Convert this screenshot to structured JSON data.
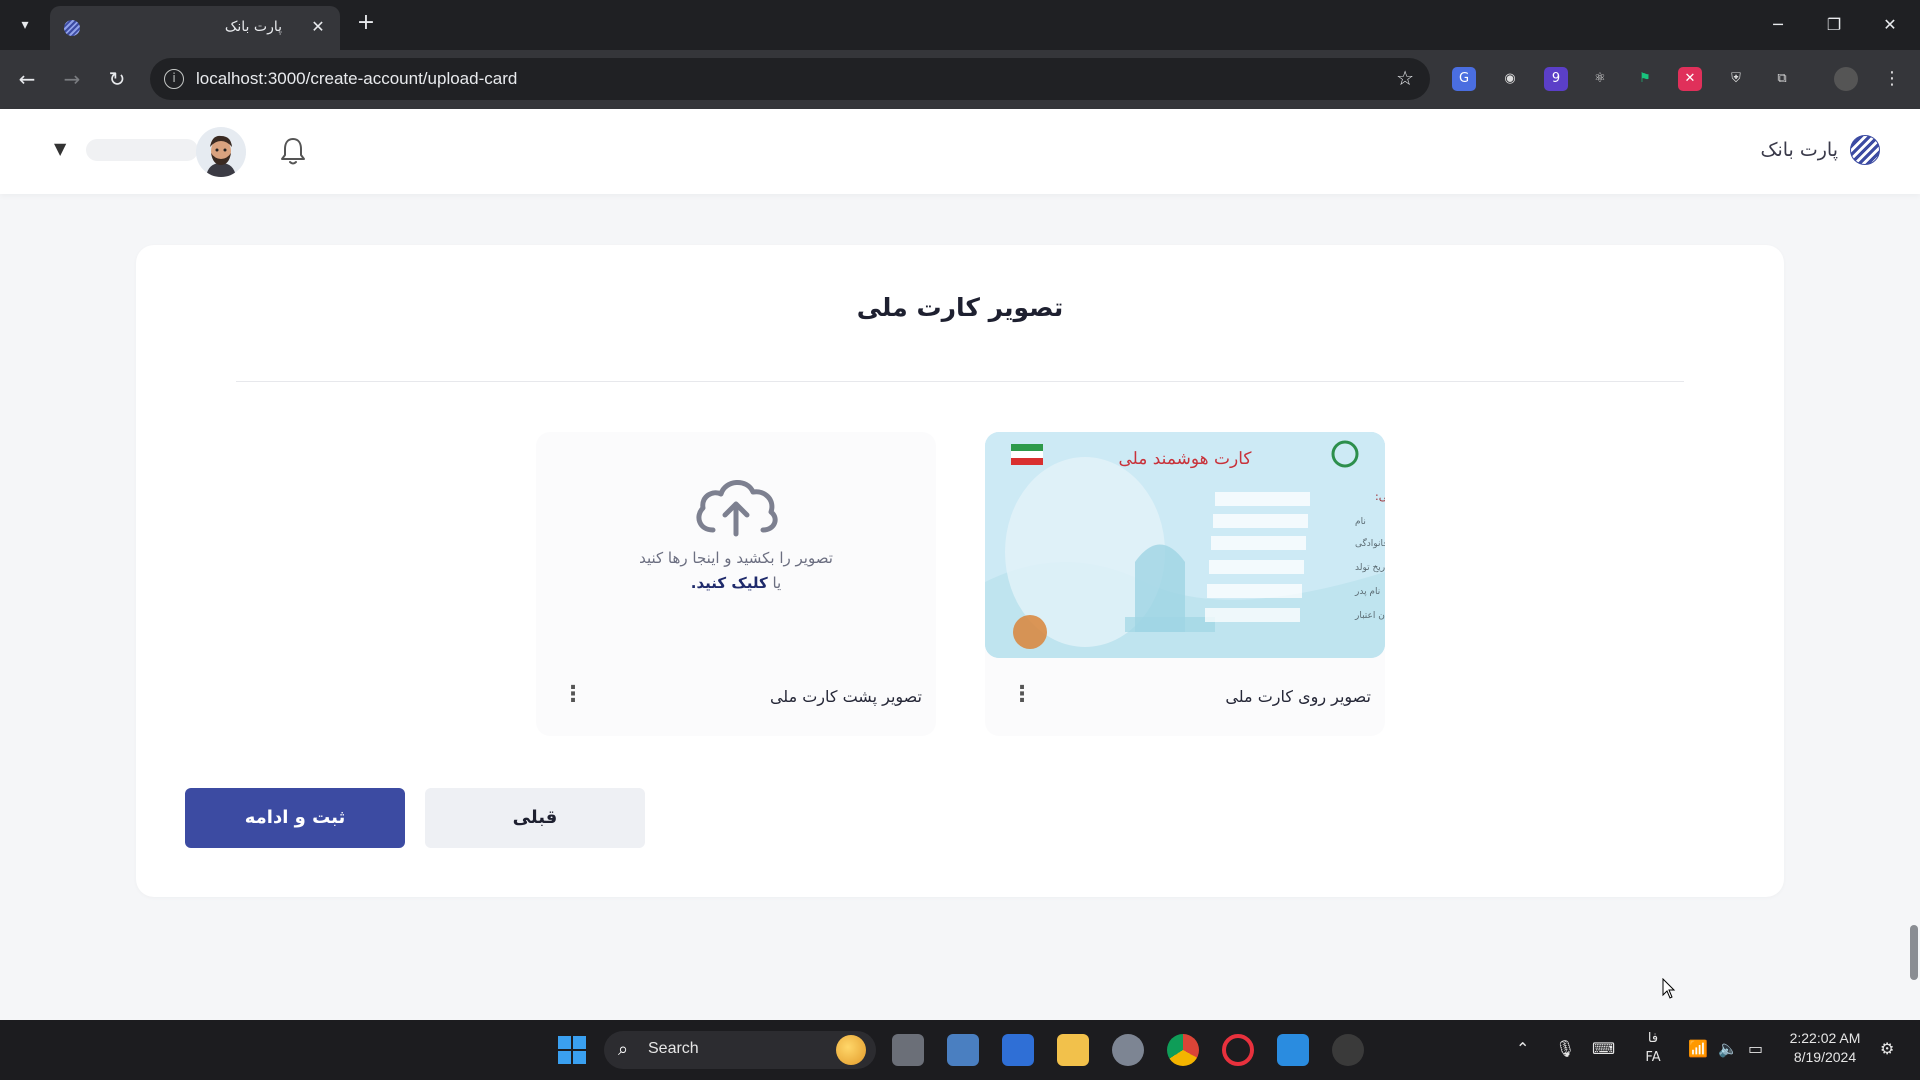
{
  "browser": {
    "tab_title": "پارت بانک",
    "url": "localhost:3000/create-account/upload-card"
  },
  "app": {
    "brand_name": "پارت بانک"
  },
  "page": {
    "title": "تصویر کارت ملی",
    "front": {
      "label": "تصویر روی کارت ملی",
      "card_title_text": "کارت هوشمند ملی",
      "card_field_label": "شماره ملی:",
      "card_fields": [
        "نام",
        "نام خانوادگی",
        "تاریخ تولد",
        "نام پدر",
        "پایان اعتبار"
      ]
    },
    "back": {
      "label": "تصویر پشت کارت ملی",
      "drop_line1": "تصویر را بکشید و اینجا رها کنید",
      "drop_line2_prefix": "یا",
      "drop_line2_link": "کلیک کنید."
    },
    "submit_label": "ثبت و ادامه",
    "prev_label": "قبلی"
  },
  "colors": {
    "primary": "#3c4ba2",
    "secondary_button": "#eef0f4",
    "page_bg": "#f5f6f8"
  },
  "icons": {
    "bell": "bell-icon",
    "cloud": "cloud-upload-icon",
    "menu": "kebab-menu-icon",
    "chevron": "chevron-down-icon"
  },
  "taskbar": {
    "search_label": "Search",
    "lang_top": "فا",
    "lang_bottom": "FA",
    "time": "2:22:02 AM",
    "date": "8/19/2024"
  }
}
